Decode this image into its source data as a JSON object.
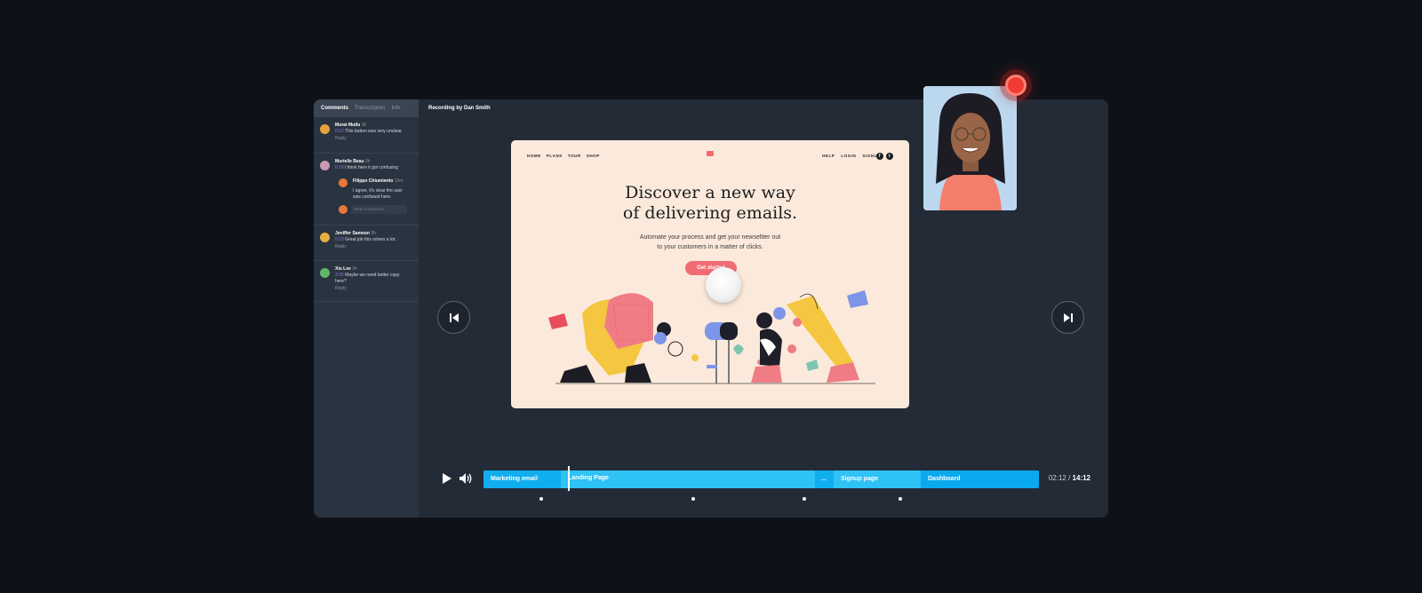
{
  "sidebar": {
    "tabs": [
      {
        "label": "Comments",
        "active": true
      },
      {
        "label": "Transcription",
        "active": false
      },
      {
        "label": "Info",
        "active": false
      }
    ],
    "comments": [
      {
        "name": "Murat Mutlu",
        "age": "3h",
        "time": "0:12",
        "text": "This button was very unclear.",
        "reply_label": "Reply",
        "avatar_color": "#e7a23a"
      },
      {
        "name": "Murielle Beau",
        "age": "3h",
        "time": "0:16",
        "text": "I think here it got confusing",
        "avatar_color": "#c79ab0",
        "reply": {
          "name": "Filippo Chiumiento",
          "age": "10m",
          "text": "I agree, it's clear the user was confused here.",
          "avatar_color": "#e8773a"
        },
        "input_placeholder": "Write a response...",
        "input_avatar_color": "#e8773a"
      },
      {
        "name": "Jeniffer Samson",
        "age": "3h",
        "time": "0:23",
        "text": "Great job this solves a lot.",
        "reply_label": "Reply",
        "avatar_color": "#e4b041"
      },
      {
        "name": "Xiu Lee",
        "age": "3h",
        "time": "3:35",
        "text": "Maybe we need better copy here?",
        "reply_label": "Reply",
        "avatar_color": "#5fb86a"
      }
    ]
  },
  "main": {
    "recording_title": "Recording by Dan Smith"
  },
  "preview": {
    "nav_left": [
      "HOME",
      "PLANS",
      "TOUR",
      "SHOP"
    ],
    "nav_right": [
      "HELP",
      "LOGIN",
      "SIGNUP"
    ],
    "social": [
      "f",
      "t"
    ],
    "headline_line1": "Discover a new way",
    "headline_line2": "of delivering emails.",
    "sub_line1": "Automate your process and get your newseltter out",
    "sub_line2": "to your customers in a matter of clicks.",
    "cta": "Get started"
  },
  "player": {
    "segments": [
      "Marketing email",
      "Landing Page",
      "...",
      "Signup page",
      "Dashboard"
    ],
    "progress": 0.153,
    "current_time": "02:12",
    "separator": " / ",
    "total_time": "14:12",
    "colors": {
      "timeline": "#0aa7ea",
      "segment_light": "#2ec2f5",
      "record": "#ef3b33",
      "comment_time": "#8f7cf3"
    }
  }
}
